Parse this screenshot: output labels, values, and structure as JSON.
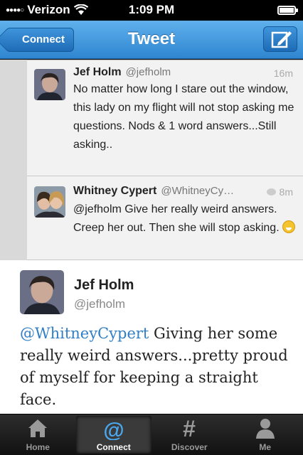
{
  "status_bar": {
    "carrier": "Verizon",
    "time": "1:09 PM",
    "battery_level": 0.9
  },
  "nav": {
    "back_label": "Connect",
    "title": "Tweet",
    "compose_icon": "compose-icon"
  },
  "thread": [
    {
      "name": "Jef Holm",
      "handle": "@jefholm",
      "time": "16m",
      "text": "No matter how long I stare out the window, this lady on my flight will not stop asking me questions. Nods & 1 word answers...Still asking.."
    },
    {
      "name": "Whitney Cypert",
      "handle": "@WhitneyCy…",
      "time": "8m",
      "text": "@jefholm Give her really weird answers. Creep her out. Then she will stop asking."
    }
  ],
  "main_tweet": {
    "name": "Jef Holm",
    "handle": "@jefholm",
    "mention": "@WhitneyCypert",
    "text": " Giving her some really weird answers...pretty proud of myself for keeping a straight face."
  },
  "tabs": [
    {
      "label": "Home",
      "icon": "home-icon",
      "active": false
    },
    {
      "label": "Connect",
      "icon": "at-icon",
      "active": true
    },
    {
      "label": "Discover",
      "icon": "hash-icon",
      "active": false
    },
    {
      "label": "Me",
      "icon": "person-icon",
      "active": false
    }
  ],
  "colors": {
    "nav_blue": "#3d97e0",
    "mention_blue": "#2f7ec6",
    "tab_bar": "#1e1e1e"
  }
}
